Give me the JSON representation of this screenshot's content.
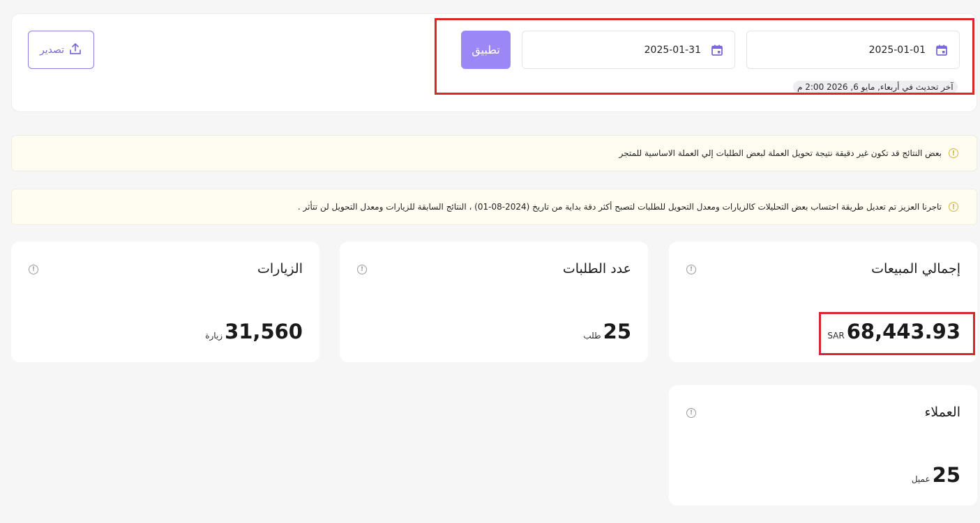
{
  "filter": {
    "start_date": "2025-01-01",
    "end_date": "2025-01-31",
    "apply_label": "تطبيق",
    "export_label": "تصدير",
    "last_update": "آخر تحديث في أربعاء, مايو 6, 2026 2:00 م"
  },
  "notices": [
    "بعض النتائج قد تكون غير دقيقة نتيجة تحويل العملة لبعض الطلبات إلي العملة الاساسية للمتجر",
    "تاجرنا العزيز تم تعديل طريقة احتساب بعض التحليلات كالزيارات ومعدل التحويل للطلبات لتصبح أكثر دقة بداية من تاريخ (2024-08-01) ، النتائج السابقة للزيارات ومعدل التحويل لن تتأثر ."
  ],
  "metrics": {
    "sales": {
      "title": "إجمالي المبيعات",
      "value": "68,443.93",
      "unit": "SAR"
    },
    "orders": {
      "title": "عدد الطلبات",
      "value": "25",
      "unit": "طلب"
    },
    "visits": {
      "title": "الزيارات",
      "value": "31,560",
      "unit": "زيارة"
    },
    "customers": {
      "title": "العملاء",
      "value": "25",
      "unit": "عميل"
    }
  },
  "colors": {
    "accent": "#9b87f5",
    "highlight": "#d9262c",
    "notice_bg": "#fffcf1",
    "warning": "#d6b43a"
  }
}
